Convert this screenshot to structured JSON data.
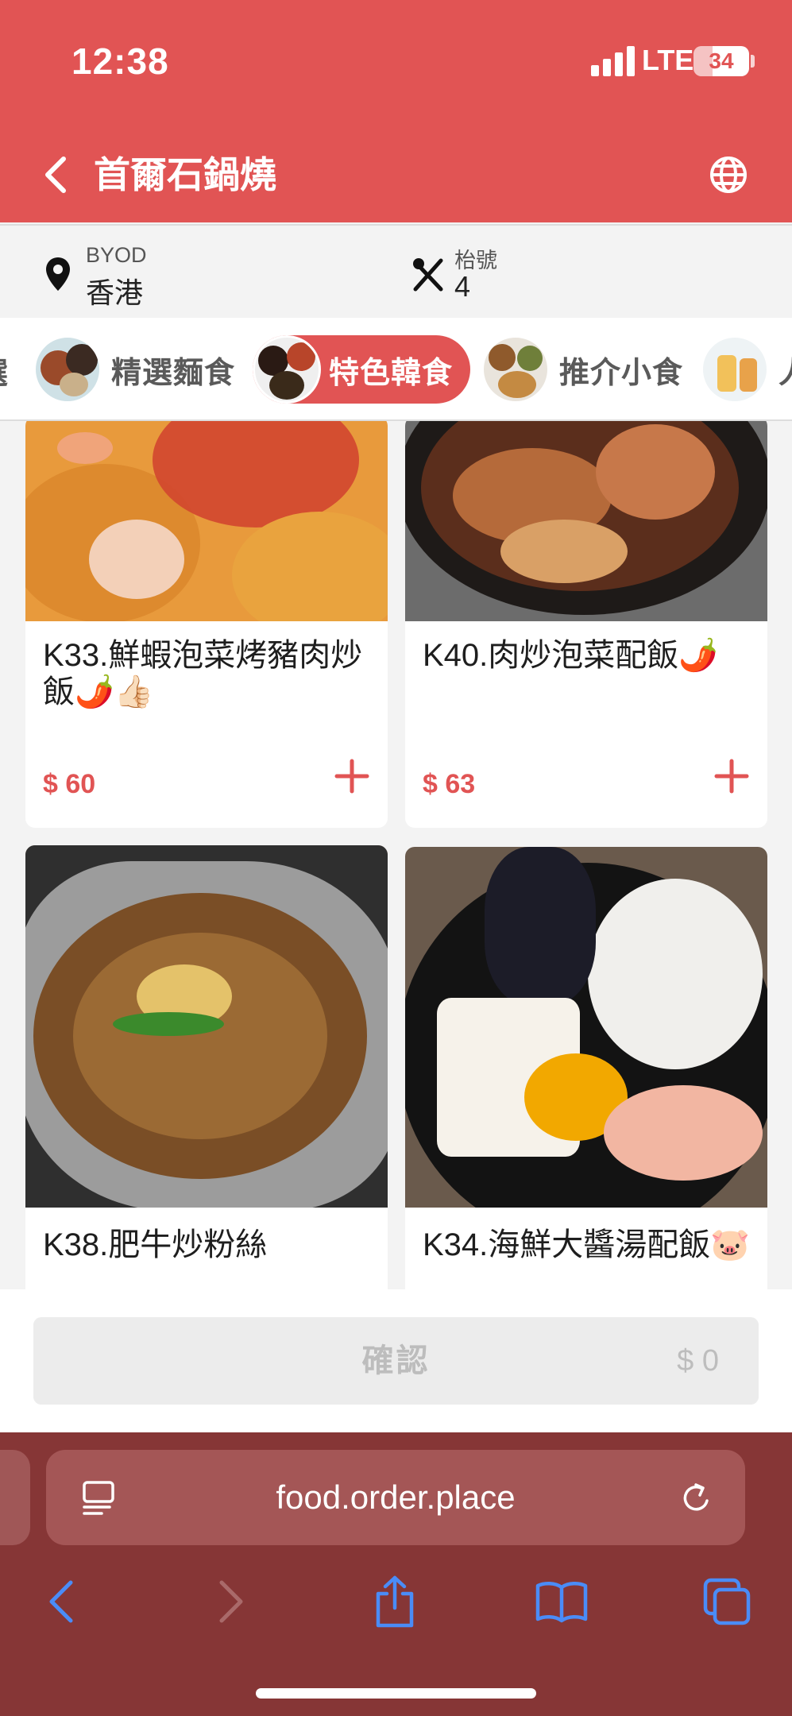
{
  "status_bar": {
    "time": "12:38",
    "network": "LTE",
    "battery": "34",
    "battery_level": 0.34
  },
  "header": {
    "title": "首爾石鍋燒"
  },
  "info": {
    "location_label": "BYOD",
    "location_value": "香港",
    "table_label": "枱號",
    "table_value": "4"
  },
  "categories": [
    {
      "label": "精選麵食",
      "active": false
    },
    {
      "label": "特色韓食",
      "active": true
    },
    {
      "label": "推介小食",
      "active": false
    }
  ],
  "items": [
    {
      "name": "K33.鮮蝦泡菜烤豬肉炒飯🌶️👍🏻",
      "price": "$ 60"
    },
    {
      "name": "K40.肉炒泡菜配飯🌶️",
      "price": "$ 63"
    },
    {
      "name": "K38.肥牛炒粉絲",
      "price": ""
    },
    {
      "name": "K34.海鮮大醬湯配飯🐷",
      "price": ""
    }
  ],
  "footer": {
    "confirm_label": "確認",
    "total": "$ 0"
  },
  "browser": {
    "url": "food.order.place"
  },
  "colors": {
    "brand": "#e15454",
    "browser_bar": "#863636",
    "toolbar_icon": "#4a8cf7"
  }
}
